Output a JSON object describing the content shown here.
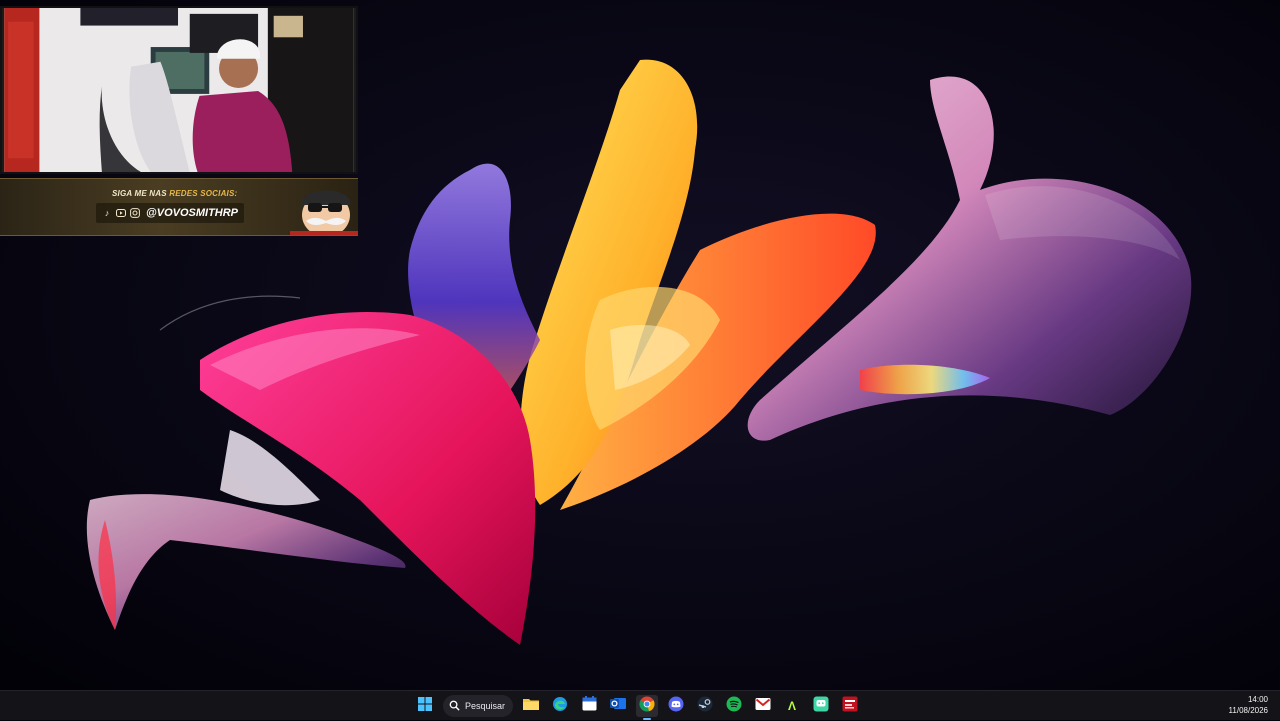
{
  "desktop": {
    "wallpaper": "windows-11-bloom-abstract",
    "colors": {
      "background": "#04030b",
      "taskbar": "#141318",
      "accent": "#68b6ff"
    }
  },
  "overlay": {
    "webcam": "streamer-webcam",
    "social_banner": {
      "title_prefix": "SIGA ME NAS ",
      "title_highlight": "REDES SOCIAIS:",
      "handle": "@VOVOSMITHRP",
      "icons": [
        "tiktok-icon",
        "youtube-icon",
        "instagram-icon"
      ]
    }
  },
  "taskbar": {
    "search_label": "Pesquisar",
    "apps": [
      {
        "name": "start",
        "icon": "windows-logo-icon"
      },
      {
        "name": "file-explorer",
        "icon": "folder-icon"
      },
      {
        "name": "edge",
        "icon": "edge-icon"
      },
      {
        "name": "calendar",
        "icon": "calendar-icon"
      },
      {
        "name": "outlook",
        "icon": "outlook-icon"
      },
      {
        "name": "chrome",
        "icon": "chrome-icon",
        "active": true
      },
      {
        "name": "discord",
        "icon": "discord-icon"
      },
      {
        "name": "steam",
        "icon": "steam-icon"
      },
      {
        "name": "spotify",
        "icon": "spotify-icon"
      },
      {
        "name": "mail",
        "icon": "mail-icon"
      },
      {
        "name": "app-a",
        "icon": "letter-a-icon"
      },
      {
        "name": "chat",
        "icon": "chat-bubble-icon"
      },
      {
        "name": "media",
        "icon": "media-app-icon"
      }
    ],
    "clock": {
      "time": "14:00",
      "date": "11/08/2026"
    }
  }
}
